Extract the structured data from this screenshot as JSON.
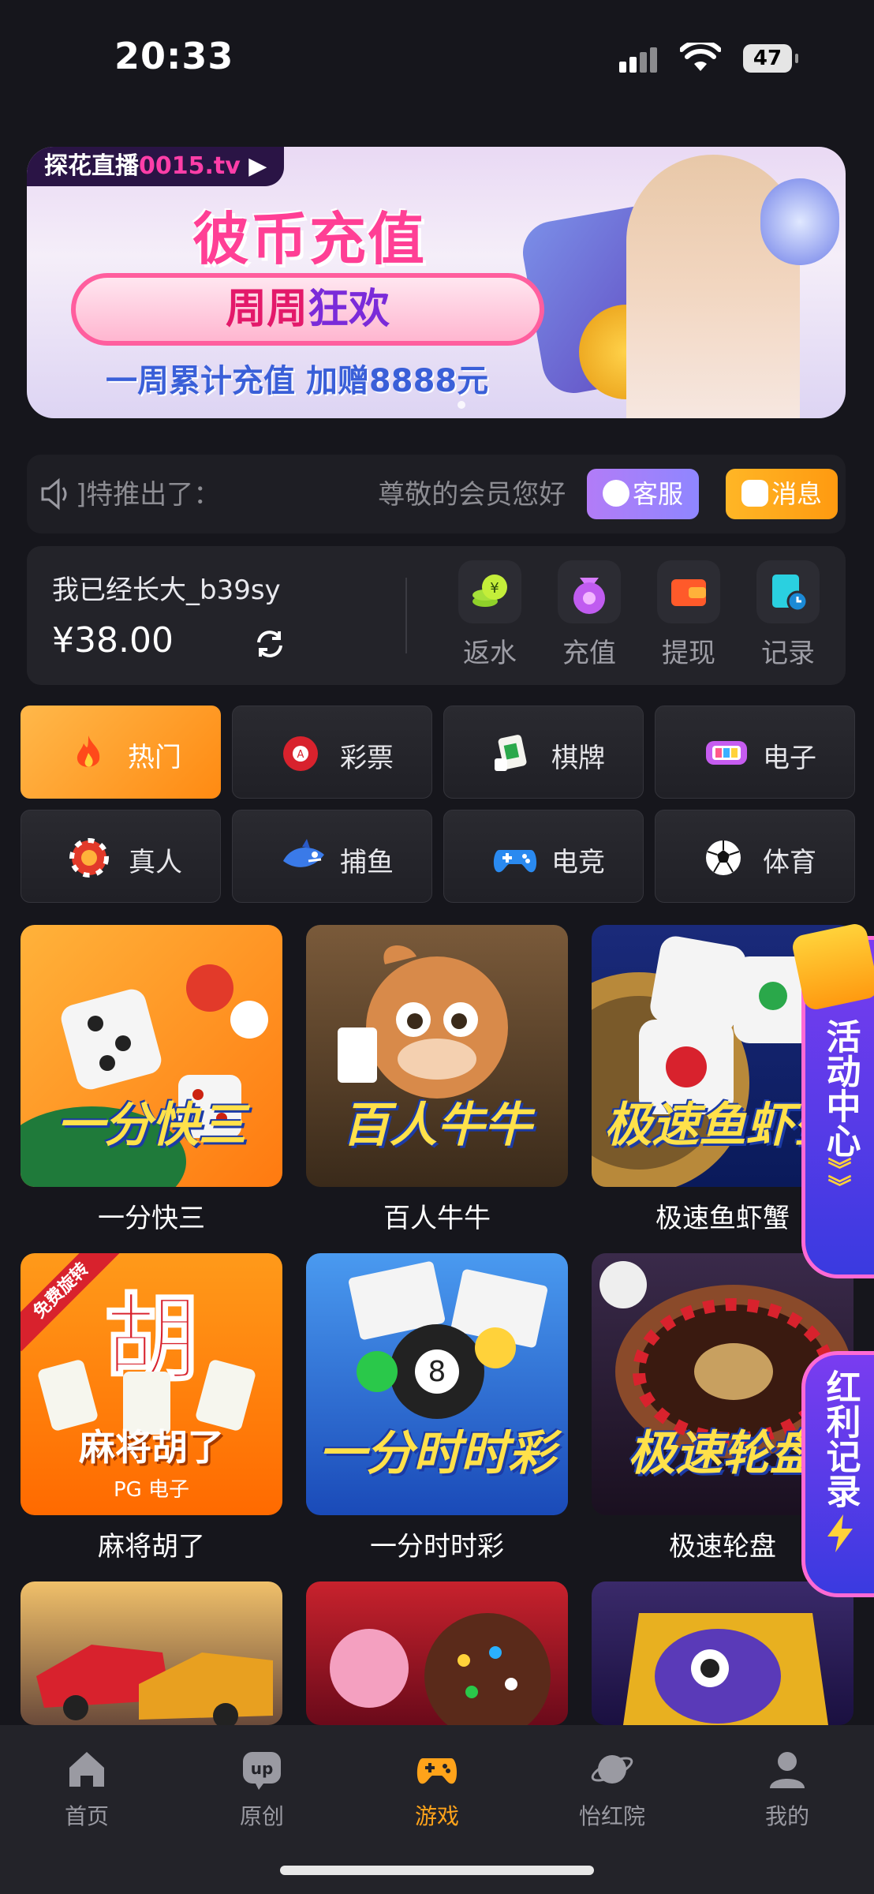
{
  "status": {
    "time": "20:33",
    "battery": "47"
  },
  "banner": {
    "tag_prefix": "探花直播",
    "tag_suffix": "0015.tv",
    "title": "彼币充值",
    "pill_a": "周周",
    "pill_b": "狂欢",
    "subtitle": "一周累计充值 加赠8888元"
  },
  "marquee": {
    "text_a": "]特推出了：",
    "text_b": "尊敬的会员您好",
    "service_label": "客服",
    "message_label": "消息"
  },
  "account": {
    "username": "我已经长大_b39sy",
    "balance": "¥38.00",
    "actions": [
      {
        "label": "返水",
        "icon": "rebate-coins-icon",
        "color": "#8fd12a"
      },
      {
        "label": "充值",
        "icon": "deposit-bag-icon",
        "color": "#c05cf0"
      },
      {
        "label": "提现",
        "icon": "wallet-icon",
        "color": "#ff5a2a"
      },
      {
        "label": "记录",
        "icon": "record-clock-icon",
        "color": "#2ad0e0"
      }
    ]
  },
  "categories": [
    {
      "label": "热门",
      "icon": "fire-icon"
    },
    {
      "label": "彩票",
      "icon": "lottery-ball-icon"
    },
    {
      "label": "棋牌",
      "icon": "mahjong-tile-icon"
    },
    {
      "label": "电子",
      "icon": "slot-machine-icon"
    },
    {
      "label": "真人",
      "icon": "casino-chip-icon"
    },
    {
      "label": "捕鱼",
      "icon": "shark-icon"
    },
    {
      "label": "电竞",
      "icon": "gamepad-icon"
    },
    {
      "label": "体育",
      "icon": "soccer-ball-icon"
    }
  ],
  "games": [
    {
      "name": "一分快三",
      "art": "一分快三"
    },
    {
      "name": "百人牛牛",
      "art": "百人牛牛"
    },
    {
      "name": "极速鱼虾蟹",
      "art": "极速鱼虾蟹"
    },
    {
      "name": "麻将胡了",
      "art": "麻将胡了",
      "sub": "PG 电子",
      "ribbon": "免费旋转"
    },
    {
      "name": "一分时时彩",
      "art": "一分时时彩"
    },
    {
      "name": "极速轮盘",
      "art": "极速轮盘"
    }
  ],
  "floats": {
    "activity": "活动中心",
    "redbonus": "红利记录"
  },
  "tabbar": [
    {
      "label": "首页",
      "icon": "home-icon"
    },
    {
      "label": "原创",
      "icon": "up-icon"
    },
    {
      "label": "游戏",
      "icon": "gamepad-icon",
      "active": true
    },
    {
      "label": "怡红院",
      "icon": "planet-icon"
    },
    {
      "label": "我的",
      "icon": "profile-icon"
    }
  ],
  "colors": {
    "accent": "#ffa31a",
    "bg": "#16161c"
  }
}
